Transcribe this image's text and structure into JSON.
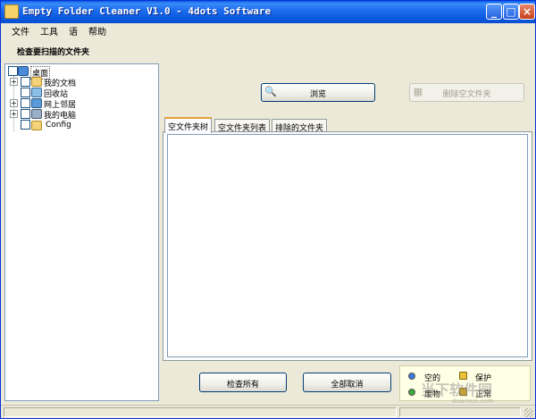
{
  "window": {
    "title": "Empty Folder Cleaner V1.0 - 4dots Software"
  },
  "menu": {
    "items": [
      "文件",
      "工具",
      "语",
      "帮助"
    ]
  },
  "tree": {
    "section_label": "检查要扫描的文件夹",
    "items": [
      {
        "label": "桌面",
        "icon": "desktop-icon",
        "expander": "",
        "selected": true
      },
      {
        "label": "我的文档",
        "icon": "folder-documents-icon",
        "expander": "+"
      },
      {
        "label": "回收站",
        "icon": "recycle-bin-icon",
        "expander": ""
      },
      {
        "label": "网上邻居",
        "icon": "network-icon",
        "expander": "+"
      },
      {
        "label": "我的电脑",
        "icon": "computer-icon",
        "expander": "+"
      },
      {
        "label": "Config",
        "icon": "folder-icon",
        "expander": ""
      }
    ]
  },
  "buttons": {
    "browse": "浏览",
    "delete_empty": "删除空文件夹",
    "check_all": "检查所有",
    "uncheck_all": "全部取消"
  },
  "tabs": [
    "空文件夹树",
    "空文件夹列表",
    "排除的文件夹"
  ],
  "legend": {
    "empty": "空的",
    "protected": "保护",
    "junk": "废物",
    "normal": "正常",
    "colors": {
      "empty": "#3a7be0",
      "junk": "#3aaa3a",
      "protected": "#e8c23a"
    }
  },
  "watermark": {
    "text": "当下软件园",
    "sub": "downxia.com"
  }
}
